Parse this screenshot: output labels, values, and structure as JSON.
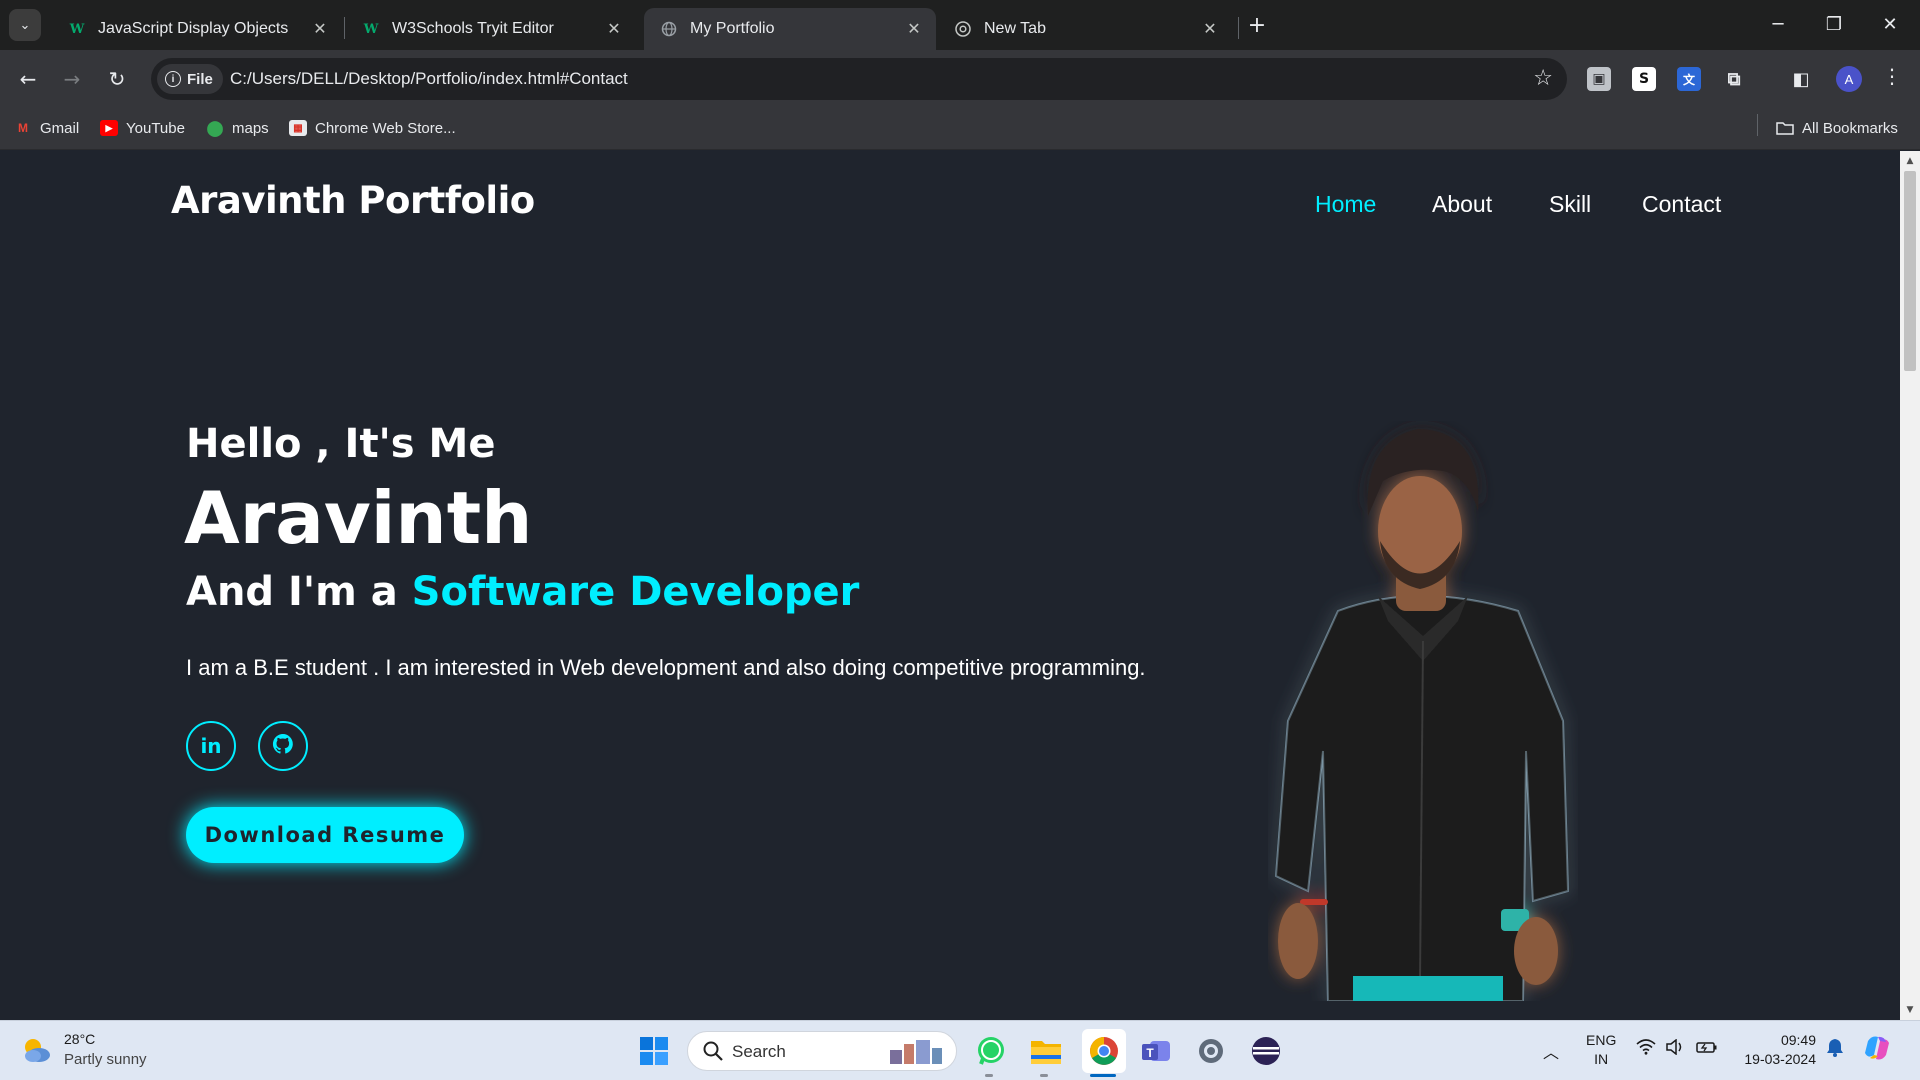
{
  "browser": {
    "tabs": [
      {
        "title": "JavaScript Display Objects",
        "favicon": "w3schools-icon",
        "active": false
      },
      {
        "title": "W3Schools Tryit Editor",
        "favicon": "w3schools-icon",
        "active": false
      },
      {
        "title": "My Portfolio",
        "favicon": "globe-icon",
        "active": true
      },
      {
        "title": "New Tab",
        "favicon": "chrome-icon",
        "active": false
      }
    ],
    "close_glyph": "✕",
    "new_tab_glyph": "+",
    "address": {
      "scheme_chip": "File",
      "url": "C:/Users/DELL/Desktop/Portfolio/index.html#Contact"
    },
    "profile_initial": "A",
    "bookmarks": [
      {
        "label": "Gmail",
        "icon": "gmail-icon"
      },
      {
        "label": "YouTube",
        "icon": "youtube-icon"
      },
      {
        "label": "maps",
        "icon": "maps-icon"
      },
      {
        "label": "Chrome Web Store...",
        "icon": "webstore-icon"
      }
    ],
    "all_bookmarks": "All Bookmarks"
  },
  "site": {
    "logo": "Aravinth Portfolio",
    "nav": [
      {
        "label": "Home",
        "active": true
      },
      {
        "label": "About",
        "active": false
      },
      {
        "label": "Skill",
        "active": false
      },
      {
        "label": "Contact",
        "active": false
      }
    ],
    "hero": {
      "greeting": "Hello , It's Me",
      "name": "Aravinth",
      "role_prefix": "And I'm a ",
      "role_highlight": "Software Developer",
      "description": "I am a B.E student . I am interested in Web development and also doing competitive programming.",
      "social": [
        {
          "label": "in",
          "icon": "linkedin-icon"
        },
        {
          "label": "",
          "icon": "github-icon"
        }
      ],
      "cta": "Download Resume"
    },
    "accent_color": "#00eeff",
    "background_color": "#1f242d"
  },
  "taskbar": {
    "weather": {
      "temp": "28°C",
      "desc": "Partly sunny"
    },
    "search_placeholder": "Search",
    "apps": [
      "start-icon",
      "whatsapp-icon",
      "file-explorer-icon",
      "chrome-icon",
      "teams-icon",
      "settings-icon",
      "eclipse-icon"
    ],
    "language": {
      "line1": "ENG",
      "line2": "IN"
    },
    "clock": {
      "time": "09:49",
      "date": "19-03-2024"
    }
  }
}
